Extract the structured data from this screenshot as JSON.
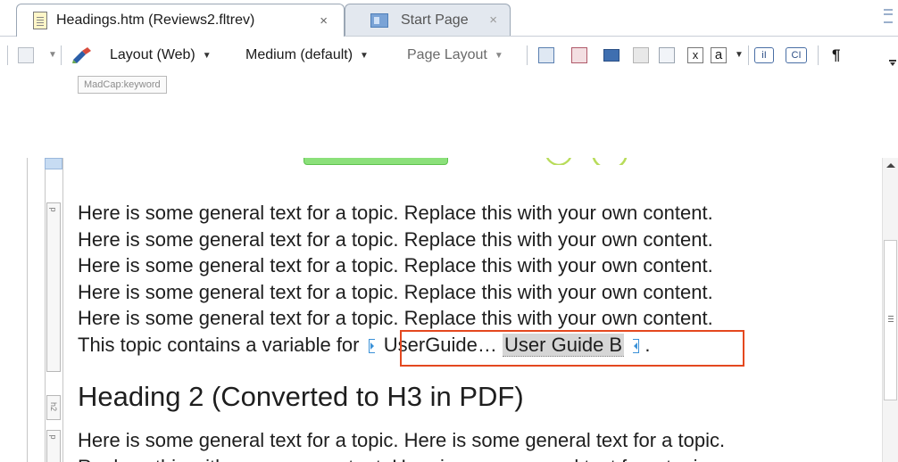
{
  "tabs": [
    {
      "label": "Headings.htm (Reviews2.fltrev)",
      "close": "×",
      "active": true
    },
    {
      "label": "Start Page",
      "close": "×",
      "active": false
    }
  ],
  "toolbar": {
    "layout_label": "Layout (Web)",
    "medium_label": "Medium (default)",
    "page_layout_label": "Page Layout",
    "pilcrow": "¶",
    "x_glyph": "x",
    "a_glyph": "a",
    "ii_glyph": "iI",
    "ci_glyph": "CI",
    "icons": [
      "page-icon",
      "style-brush-icon",
      "preview-icon",
      "print-preview-icon",
      "window-icon",
      "tracking-icon",
      "xref-icon",
      "text-icon",
      "insert-variable-icon",
      "insert-condition-icon"
    ]
  },
  "structure": {
    "keyword_tag": "MadCap:keyword"
  },
  "editor": {
    "paragraph_lines": [
      "Here is some general text for a topic. Replace this with your own content.",
      "Here is some general text for a topic. Replace this with your own content.",
      "Here is some general text for a topic. Replace this with your own content.",
      "Here is some general text for a topic. Replace this with your own content.",
      "Here is some general text for a topic. Replace this with your own content."
    ],
    "variable_line_prefix": "This topic contains a variable for",
    "variable_name": "UserGuide…",
    "variable_value": "User Guide B",
    "variable_line_suffix": ".",
    "heading": "Heading 2 (Converted to H3 in PDF)",
    "last_paragraph": "Here is some general text for a topic. Here is some general text for a topic.",
    "cut_line": "Replace this with your own content. Here is some general text for a topic.",
    "tag_labels": {
      "p": "p",
      "h2": "h2"
    }
  },
  "colors": {
    "highlight_border": "#e4481f",
    "variable_marker": "#3a91d8",
    "heading_image": "#8be07a"
  }
}
